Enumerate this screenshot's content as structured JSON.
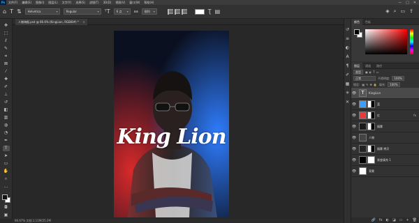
{
  "app": {
    "logo": "Ps"
  },
  "menu": [
    "文件(F)",
    "编辑(E)",
    "图像(I)",
    "图层(L)",
    "文字(Y)",
    "选择(S)",
    "滤镜(T)",
    "3D(D)",
    "视图(V)",
    "窗口(W)",
    "帮助(H)"
  ],
  "window_controls": [
    "—",
    "□",
    "✕"
  ],
  "options": {
    "font_family": "Helvetica",
    "font_style": "Regular",
    "font_size": "6 点",
    "anti_alias": "锐利",
    "text_color": "#ffffff"
  },
  "document": {
    "tab_title": "人物海报.psd @ 66.6% (KingLion, RGB/8#) *",
    "tab_close": "×"
  },
  "artwork": {
    "title": "King Lion"
  },
  "status": {
    "text": "66.67%    文档:1.11M/25.2M"
  },
  "panels": {
    "color_tabs": [
      "颜色",
      "色板"
    ],
    "layer_tabs": [
      "图层",
      "通道",
      "路径"
    ],
    "kind_filter": "类型",
    "blend_mode": "正常",
    "opacity_label": "不透明度:",
    "opacity_value": "100%",
    "lock_label": "锁定:",
    "fill_label": "填充:",
    "fill_value": "100%"
  },
  "layers": [
    {
      "name": "KingLion",
      "thumb": "text",
      "selected": true,
      "visible": true,
      "fx": ""
    },
    {
      "name": "蓝",
      "thumb": "#3aa0ff",
      "mask": true,
      "visible": true,
      "fx": ""
    },
    {
      "name": "红",
      "thumb": "#e83a3a",
      "mask": true,
      "visible": true,
      "fx": "fx"
    },
    {
      "name": "烟雾",
      "thumb": "#1a1a1a",
      "mask": true,
      "visible": true,
      "fx": ""
    },
    {
      "name": "人物",
      "thumb": "#444444",
      "visible": true,
      "fx": ""
    },
    {
      "name": "烟雾 拷贝",
      "thumb": "#222222",
      "mask": true,
      "visible": true,
      "fx": ""
    },
    {
      "name": "渐变填充 1",
      "thumb": "#000000",
      "mask": true,
      "visible": true,
      "fx": ""
    },
    {
      "name": "背景",
      "thumb": "#ffffff",
      "visible": true,
      "fx": ""
    }
  ],
  "panel_footer_icons": [
    "🔗",
    "fx",
    "◐",
    "◪",
    "▭",
    "+",
    "🗑"
  ]
}
